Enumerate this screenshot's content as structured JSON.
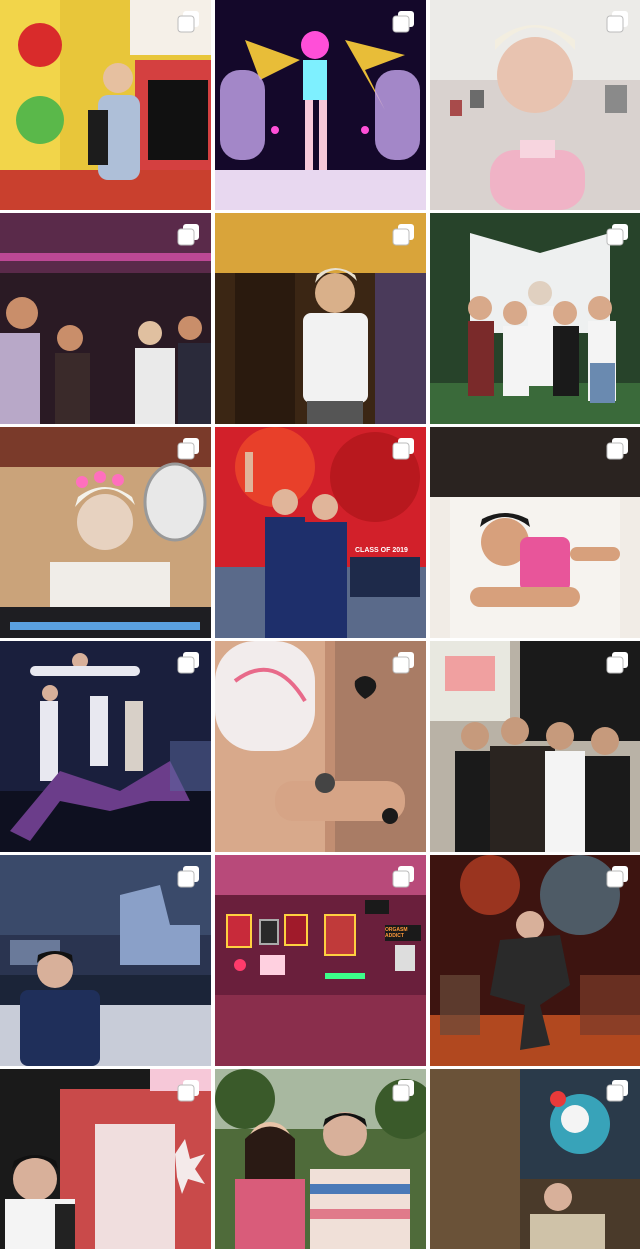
{
  "grid": {
    "tiles": [
      {
        "id": 1,
        "overlay_icon": "multiple-photos-icon",
        "caption_visible": "",
        "colors": {
          "bg": "#e8c63a",
          "accent": "#d92b2b",
          "figure": "#aebfd8"
        }
      },
      {
        "id": 2,
        "overlay_icon": "multiple-photos-icon",
        "caption_visible": "",
        "colors": {
          "bg": "#14082a",
          "accent": "#ff4fd8",
          "figure": "#7ef0ff"
        }
      },
      {
        "id": 3,
        "overlay_icon": "multiple-photos-icon",
        "caption_visible": "",
        "colors": {
          "bg": "#d9d2cf",
          "accent": "#f0b3c6",
          "figure": "#e8c3b0"
        }
      },
      {
        "id": 4,
        "overlay_icon": "multiple-photos-icon",
        "caption_visible": "",
        "colors": {
          "bg": "#2a1a24",
          "accent": "#ff5ec8",
          "figure": "#c98e6a"
        }
      },
      {
        "id": 5,
        "overlay_icon": "multiple-photos-icon",
        "caption_visible": "",
        "colors": {
          "bg": "#3b2614",
          "accent": "#f2f2f2",
          "figure": "#d9b08a"
        }
      },
      {
        "id": 6,
        "overlay_icon": "multiple-photos-icon",
        "caption_visible": "",
        "colors": {
          "bg": "#27432a",
          "accent": "#f4f4f4",
          "figure": "#d8a98a"
        }
      },
      {
        "id": 7,
        "overlay_icon": "multiple-photos-icon",
        "caption_visible": "",
        "colors": {
          "bg": "#caa37a",
          "accent": "#ff6fbe",
          "figure": "#e7d2c0"
        }
      },
      {
        "id": 8,
        "overlay_icon": "multiple-photos-icon",
        "caption_visible": "CLASS OF 2019",
        "colors": {
          "bg": "#d2202a",
          "accent": "#1e2f6b",
          "figure": "#e0b59a"
        }
      },
      {
        "id": 9,
        "overlay_icon": "multiple-photos-icon",
        "caption_visible": "",
        "colors": {
          "bg": "#f1ece6",
          "accent": "#e8559a",
          "figure": "#d7a07c"
        }
      },
      {
        "id": 10,
        "overlay_icon": "multiple-photos-icon",
        "caption_visible": "",
        "colors": {
          "bg": "#1a1f3d",
          "accent": "#e8e8f0",
          "figure": "#6b3d8a"
        }
      },
      {
        "id": 11,
        "overlay_icon": "multiple-photos-icon",
        "caption_visible": "",
        "colors": {
          "bg": "#d8a98b",
          "accent": "#1a1a1a",
          "figure": "#c28e72"
        }
      },
      {
        "id": 12,
        "overlay_icon": "multiple-photos-icon",
        "caption_visible": "",
        "colors": {
          "bg": "#b9b2a6",
          "accent": "#2a2420",
          "figure": "#c69a7c"
        }
      },
      {
        "id": 13,
        "overlay_icon": "multiple-photos-icon",
        "caption_visible": "",
        "colors": {
          "bg": "#1b2438",
          "accent": "#8aa0c8",
          "figure": "#1f2f5a"
        }
      },
      {
        "id": 14,
        "overlay_icon": "multiple-photos-icon",
        "caption_visible": "ORGASM ADDICT",
        "colors": {
          "bg": "#6a1f3c",
          "accent": "#ff3b6b",
          "figure": "#3cff8a"
        }
      },
      {
        "id": 15,
        "overlay_icon": "multiple-photos-icon",
        "caption_visible": "",
        "colors": {
          "bg": "#3d1410",
          "accent": "#ff6a2a",
          "figure": "#2a2a2a"
        }
      },
      {
        "id": 16,
        "overlay_icon": "multiple-photos-icon",
        "caption_visible": "",
        "colors": {
          "bg": "#c94a4a",
          "accent": "#f0dede",
          "figure": "#2a2a2a"
        }
      },
      {
        "id": 17,
        "overlay_icon": "multiple-photos-icon",
        "caption_visible": "",
        "colors": {
          "bg": "#4f6b3a",
          "accent": "#d95c7a",
          "figure": "#e8c4a8"
        }
      },
      {
        "id": 18,
        "overlay_icon": "multiple-photos-icon",
        "caption_visible": "",
        "colors": {
          "bg": "#4a3a2a",
          "accent": "#3fd0e8",
          "figure": "#cfc2a8"
        }
      }
    ]
  }
}
